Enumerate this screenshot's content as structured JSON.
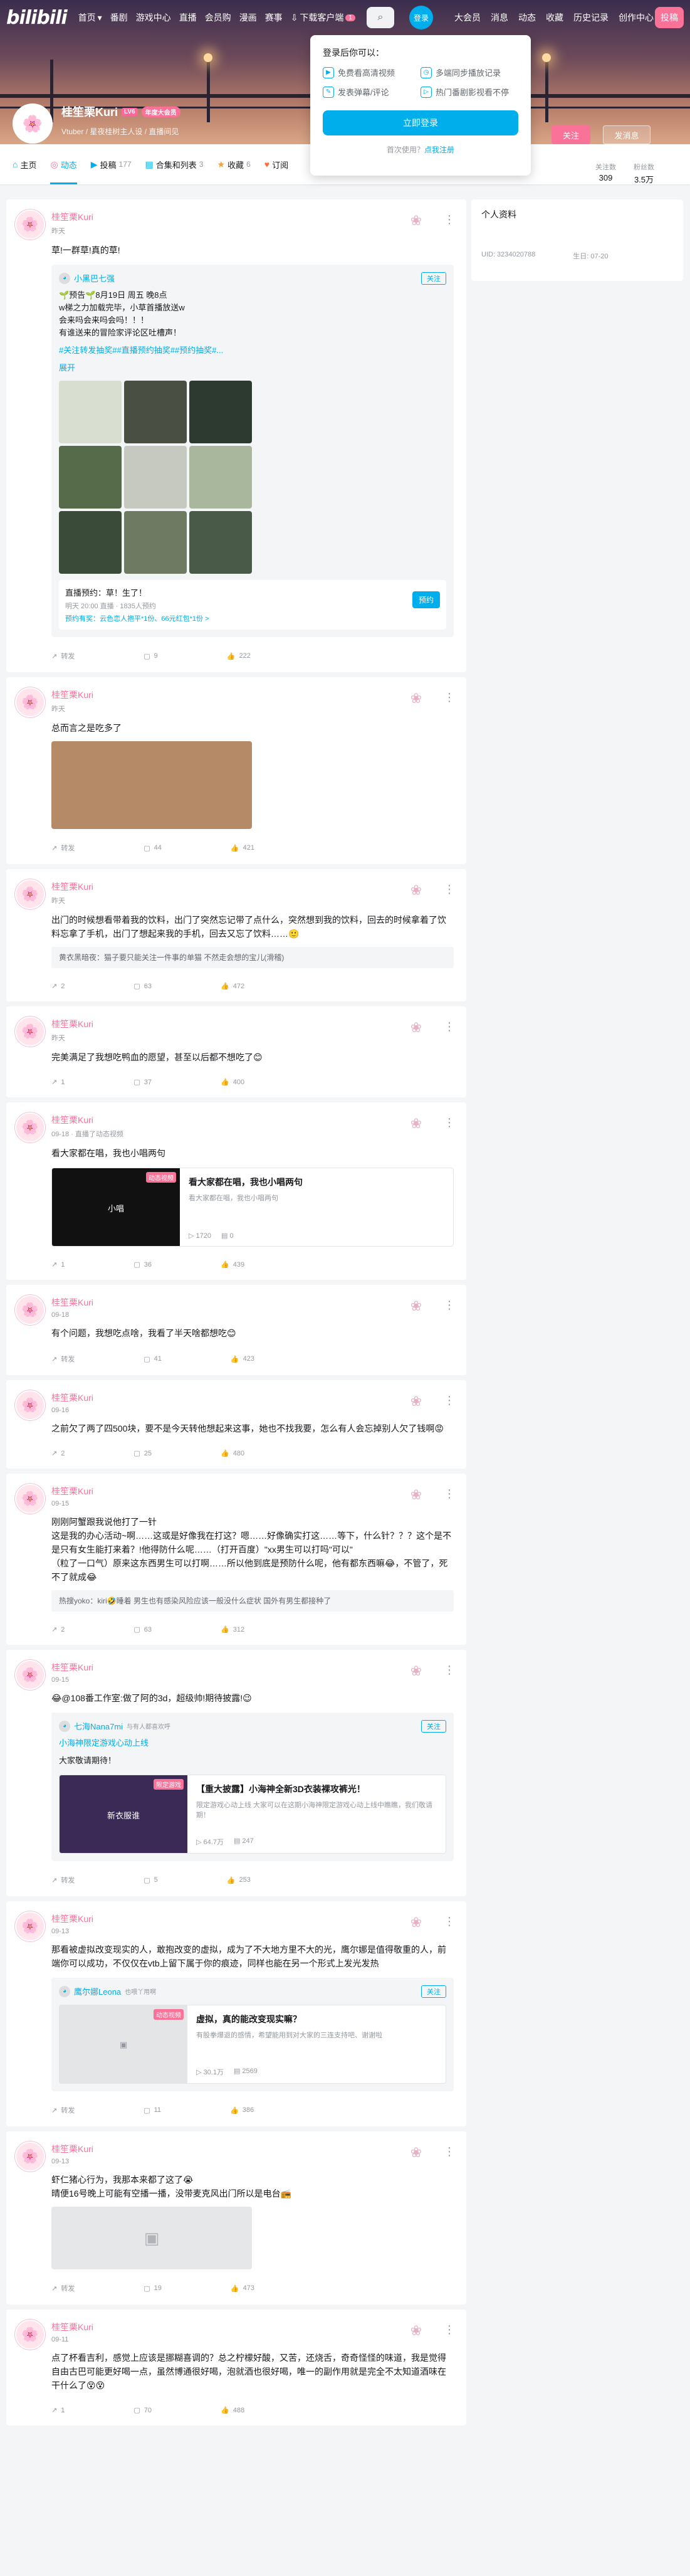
{
  "top": {
    "logo": "bilibili",
    "nav": [
      "首页",
      "番剧",
      "游戏中心",
      "直播",
      "会员购",
      "漫画",
      "赛事"
    ],
    "download": "下载客户端",
    "download_badge": "1",
    "login": "登录",
    "right": [
      "大会员",
      "消息",
      "动态",
      "收藏",
      "历史记录",
      "创作中心"
    ],
    "upload": "投稿"
  },
  "popup": {
    "title": "登录后你可以：",
    "items": [
      "免费看高清视频",
      "多端同步播放记录",
      "发表弹幕/评论",
      "热门番剧影视看不停"
    ],
    "login_btn": "立即登录",
    "reg_q": "首次使用？",
    "reg_link": "点我注册"
  },
  "profile": {
    "name": "桂笙栗Kuri",
    "level": "LV6",
    "vip": "年度大会员",
    "sign": "Vtuber / 星夜桂树主人设 / 直播间见",
    "follow": "关注",
    "message": "发消息"
  },
  "tabs": [
    {
      "icon": "⌂",
      "label": "主页",
      "count": ""
    },
    {
      "icon": "◎",
      "label": "动态",
      "count": ""
    },
    {
      "icon": "▶",
      "label": "投稿",
      "count": "177"
    },
    {
      "icon": "▤",
      "label": "合集和列表",
      "count": "3"
    },
    {
      "icon": "★",
      "label": "收藏",
      "count": "6"
    },
    {
      "icon": "♥",
      "label": "订阅",
      "count": ""
    }
  ],
  "stats": {
    "following_label": "关注数",
    "following": "309",
    "fans_label": "粉丝数",
    "fans": "3.5万"
  },
  "side": {
    "title": "个人资料",
    "uid": "UID: 3234020788",
    "birthday": "生日: 07-20"
  },
  "posts": [
    {
      "time": "昨天",
      "text": "草!一群草!真的草!",
      "fwd_name": "小黑巴七强",
      "fwd_follow": "关注",
      "fwd_text": "🌱预告🌱8月19日 周五 晚8点\nw梯之力加载完毕，小草首播放送w\n会来吗会来吗会吗！！！\n有谁送来的冒险家评论区吐槽声！",
      "fwd_tags": "#关注转发抽奖##直播预约抽奖##预约抽奖#...",
      "fwd_expand": "展开",
      "live_title": "直播预约：草！生了！",
      "live_sub": "明天 20:00 直播 · 1835人预约",
      "live_reward": "预约有奖：云色恋人抱平*1份、66元红包*1份 >",
      "live_btn": "预约",
      "fwd_count": "转发",
      "comments": "9",
      "likes": "222"
    },
    {
      "time": "昨天",
      "text": "总而言之是吃多了",
      "fwd_count": "转发",
      "comments": "44",
      "likes": "421"
    },
    {
      "time": "昨天",
      "text": "出门的时候想看带着我的饮料，出门了突然忘记带了点什么，突然想到我的饮料，回去的时候拿着了饮料忘拿了手机，出门了想起来我的手机，回去又忘了饮料……🙂",
      "reply": "黄衣黑暗夜：猫子要只能关注一件事的单猫 不然走会想的宝儿(滑稽)",
      "fwd_count": "2",
      "comments": "63",
      "likes": "472"
    },
    {
      "time": "昨天",
      "text": "完美满足了我想吃鸭血的愿望，甚至以后都不想吃了😊",
      "fwd_count": "1",
      "comments": "37",
      "likes": "400"
    },
    {
      "time": "09-18 · 直播了动态视频",
      "text": "看大家都在唱，我也小唱两句",
      "video_tag": "动态视频",
      "video_thumb": "小唱",
      "video_title": "看大家都在唱，我也小唱两句",
      "video_desc": "看大家都在唱，我也小唱两句",
      "video_plays": "1720",
      "video_dm": "0",
      "fwd_count": "1",
      "comments": "36",
      "likes": "439"
    },
    {
      "time": "09-18",
      "text": "有个问题，我想吃点啥，我看了半天啥都想吃😊",
      "fwd_count": "转发",
      "comments": "41",
      "likes": "423"
    },
    {
      "time": "09-16",
      "text": "之前欠了两了四500块，要不是今天转他想起来这事，她也不找我要，怎么有人会忘掉别人欠了钱啊😡",
      "fwd_count": "2",
      "comments": "25",
      "likes": "480"
    },
    {
      "time": "09-15",
      "text": "刚刚阿蟹跟我说他打了一针\n这是我的办心活动~啊……这或是好像我在打这？嗯……好像确实打这……等下，什么针？？？这个是不是只有女生能打来着？!他得防什么呢……（打开百度）\"xx男生可以打吗\"可以\"\n（粒了一口气）原来这东西男生可以打啊……所以他到底是预防什么呢，他有都东西嘛😂，不管了，死不了就成😂",
      "reply": "热搜yoko：kiri🤣睡着 男生也有感染风险应该一般没什么症状 国外有男生都接种了",
      "fwd_count": "2",
      "comments": "63",
      "likes": "312"
    },
    {
      "time": "09-15",
      "text": "😂@108番工作室:做了阿的3d，超级帅!期待披露!😉",
      "fwd_name": "七海Nana7mi",
      "fwd_sub": "与有人都喜欢呼",
      "fwd_follow": "关注",
      "fwd_link": "小海神限定游戏心动上线",
      "fwd_text": "大家敬请期待！",
      "video_tag": "限定游戏",
      "video_thumb": "新衣服谁",
      "video_title": "【重大披露】小海神全新3D衣装裸攻裤光！",
      "video_desc": "限定游戏心动上线 大家可以在这期小海神限定游戏心动上线中瞧瞧，我们敬请期！",
      "video_plays": "64.7万",
      "video_dm": "247",
      "fwd_count": "转发",
      "comments": "5",
      "likes": "253"
    },
    {
      "time": "09-13",
      "text": "那看被虚拟改变现实的人，敢抱改变的虚拟，成为了不大地方里不大的光，鹰尔娜是值得敬重的人，前端你可以成功，不仅仅在vtb上留下属于你的痕迹，同样也能在另一个形式上发光发热",
      "fwd_name": "鹰尔娜Leona",
      "fwd_sub": "也喂丫用啊",
      "fwd_follow": "关注",
      "video_tag": "动态视频",
      "video_title": "虚拟，真的能改变现实嘛？",
      "video_desc": "有股拳爆退的感情，希望能用到对大家的三连支持吧、谢谢啦",
      "video_plays": "30.1万",
      "video_dm": "2569",
      "fwd_count": "转发",
      "comments": "11",
      "likes": "386"
    },
    {
      "time": "09-13",
      "text": "虾仁猪心行为，我那本来都了这了😭\n晴便16号晚上可能有空播一播，没带麦克风出门所以是电台📻",
      "fwd_count": "转发",
      "comments": "19",
      "likes": "473"
    },
    {
      "time": "09-11",
      "text": "点了杯看吉利，感觉上应该是挪糊喜调的？总之柠檬好酸，又苦，还烧舌，奇奇怪怪的味道，我是觉得自由古巴可能更好喝一点，虽然博通很好喝，泡就酒也很好喝，唯一的副作用就是完全不太知道酒味在干什么了😵😵",
      "fwd_count": "1",
      "comments": "70",
      "likes": "488"
    }
  ]
}
